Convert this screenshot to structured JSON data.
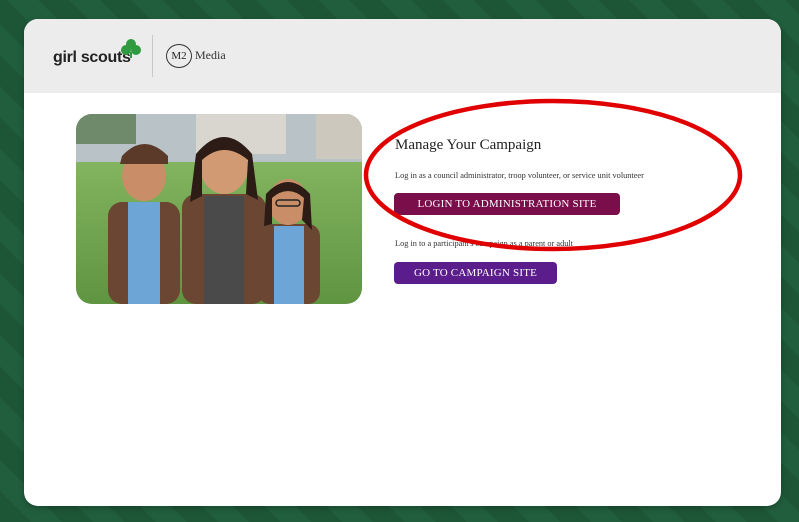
{
  "header": {
    "brand": "girl scouts",
    "partner_badge": "M2",
    "partner_label": "Media"
  },
  "main": {
    "title": "Manage Your Campaign",
    "admin_description": "Log in as a council administrator, troop volunteer, or service unit volunteer",
    "admin_button_label": "LOGIN TO ADMINISTRATION SITE",
    "parent_description": "Log in to a participant's campaign as a parent or adult",
    "campaign_button_label": "GO TO CAMPAIGN SITE"
  },
  "colors": {
    "frame": "#1f5a3a",
    "admin_button": "#7a0e4a",
    "campaign_button": "#5b1d8c",
    "annotation": "#e00000"
  }
}
